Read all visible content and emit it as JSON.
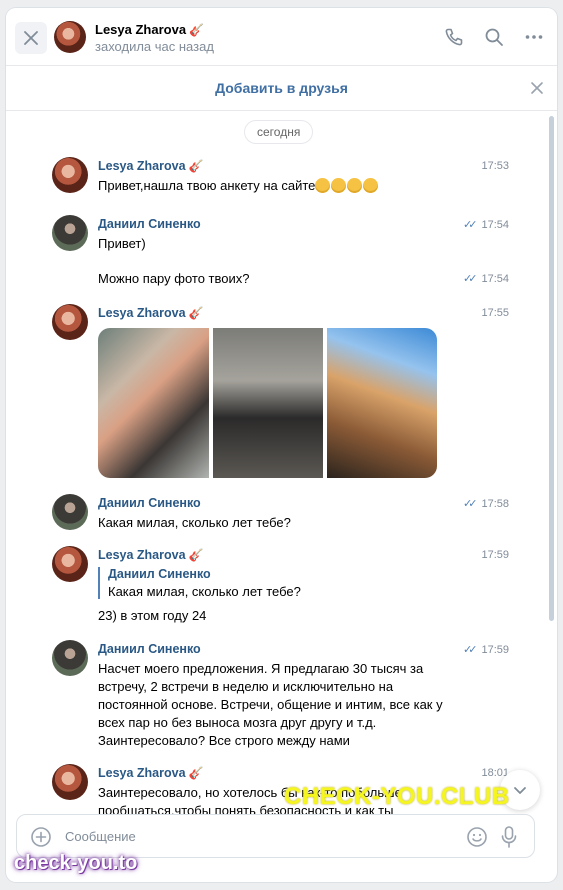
{
  "header": {
    "name": "Lesya Zharova",
    "name_badge": "🎸",
    "status": "заходила час назад",
    "icons": [
      "close-icon",
      "phone-icon",
      "search-icon",
      "more-icon"
    ]
  },
  "friend_bar": {
    "label": "Добавить в друзья"
  },
  "date_pill": "сегодня",
  "messages": [
    {
      "author": "Lesya Zharova",
      "badge": "🎸",
      "time": "17:53",
      "text": "Привет,нашла твою анкету на сайте",
      "emoji_count": 4
    },
    {
      "author": "Даниил Синенко",
      "time": "17:54",
      "text": "Привет)"
    },
    {
      "author": "",
      "time": "17:54",
      "text": "Можно пару фото твоих?"
    },
    {
      "author": "Lesya Zharova",
      "badge": "🎸",
      "time": "17:55",
      "photos": 3
    },
    {
      "author": "Даниил Синенко",
      "time": "17:58",
      "text": "Какая милая, сколько лет тебе?"
    },
    {
      "author": "Lesya Zharova",
      "badge": "🎸",
      "time": "17:59",
      "quote_author": "Даниил Синенко",
      "quote_text": "Какая милая, сколько лет тебе?",
      "text": "23) в этом году 24"
    },
    {
      "author": "Даниил Синенко",
      "time": "17:59",
      "text": "Насчет моего предложения. Я предлагаю 30 тысяч за встречу, 2 встречи в неделю и исключительно на постоянной основе. Встречи, общение и интим, все как у всех пар но без выноса мозга друг другу и т.д. Заинтересовало? Все строго между нами"
    },
    {
      "author": "Lesya Zharova",
      "badge": "🎸",
      "time": "18:01",
      "text": "Заинтересовало, но хотелось бы как-то побольше пообщаться,чтобы понять безопасность и как ты представляешь встречи?)"
    }
  ],
  "composer": {
    "placeholder": "Сообщение"
  },
  "watermarks": {
    "big": "CHECK-YOU.CLUB",
    "small": "check-you.to"
  },
  "colors": {
    "link": "#2a5885",
    "accent": "#5181b8",
    "muted": "#818c99"
  }
}
